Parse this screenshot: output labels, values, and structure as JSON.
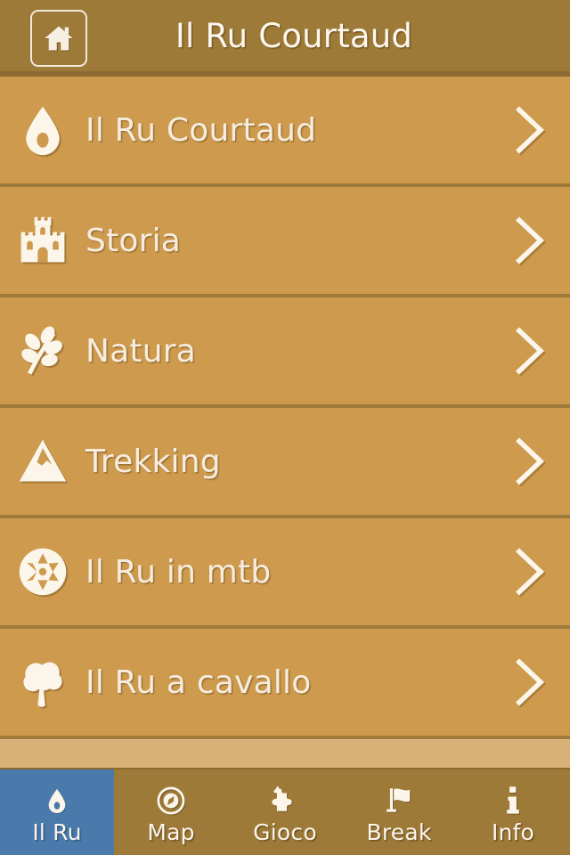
{
  "header": {
    "title": "Il Ru Courtaud",
    "home_button": "home-icon"
  },
  "list": {
    "items": [
      {
        "label": "Il Ru Courtaud",
        "icon": "water-drop-icon"
      },
      {
        "label": "Storia",
        "icon": "castle-icon"
      },
      {
        "label": "Natura",
        "icon": "leaf-branch-icon"
      },
      {
        "label": "Trekking",
        "icon": "mountain-icon"
      },
      {
        "label": "Il Ru in mtb",
        "icon": "bike-wheel-icon"
      },
      {
        "label": "Il Ru a cavallo",
        "icon": "tree-icon"
      }
    ]
  },
  "tabbar": {
    "items": [
      {
        "label": "Il Ru",
        "icon": "water-drop-icon",
        "active": true
      },
      {
        "label": "Map",
        "icon": "compass-icon",
        "active": false
      },
      {
        "label": "Gioco",
        "icon": "puzzle-icon",
        "active": false
      },
      {
        "label": "Break",
        "icon": "flag-icon",
        "active": false
      },
      {
        "label": "Info",
        "icon": "info-icon",
        "active": false
      }
    ]
  },
  "colors": {
    "header_bg": "#9d7a38",
    "row_bg": "#cd9a4e",
    "list_bg": "#d9b178",
    "accent_blue": "#4a7aab",
    "text_cream": "#f6ecdf"
  }
}
